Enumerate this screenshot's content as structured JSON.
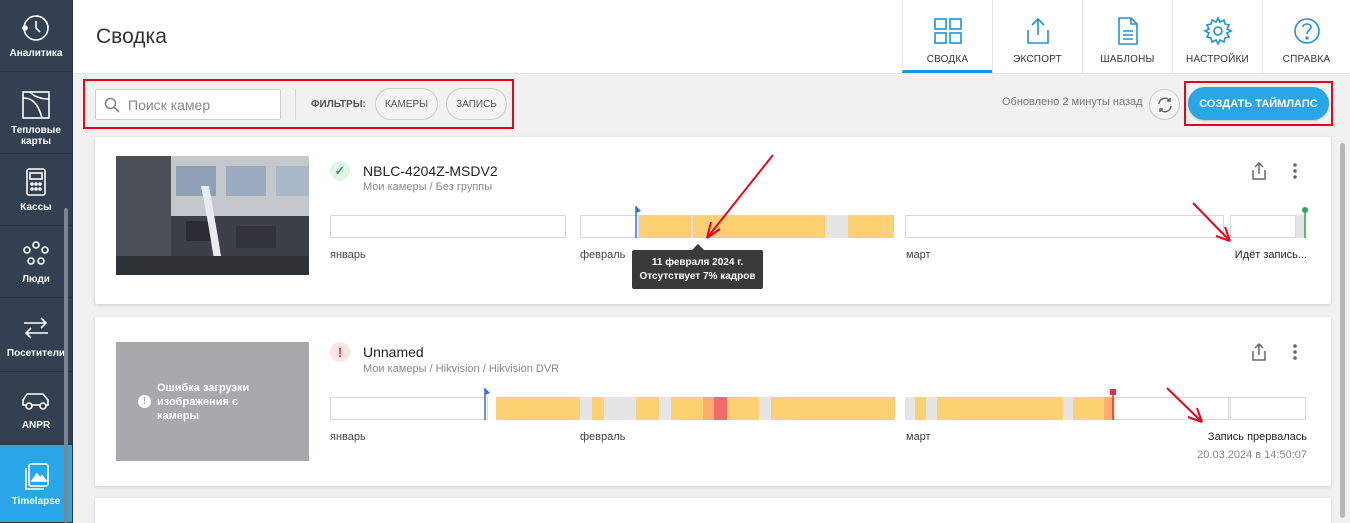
{
  "sidebar": {
    "items": [
      {
        "label": "Аналитика",
        "icon": "analytics-icon"
      },
      {
        "label": "Тепловые карты",
        "icon": "heatmap-icon"
      },
      {
        "label": "Кассы",
        "icon": "cash-register-icon"
      },
      {
        "label": "Люди",
        "icon": "people-icon"
      },
      {
        "label": "Посетители",
        "icon": "visitors-icon"
      },
      {
        "label": "ANPR",
        "icon": "car-icon"
      },
      {
        "label": "Timelapse",
        "icon": "timelapse-icon",
        "active": true
      }
    ]
  },
  "header": {
    "title": "Сводка",
    "nav": [
      {
        "label": "СВОДКА",
        "icon": "dashboard-icon",
        "active": true
      },
      {
        "label": "ЭКСПОРТ",
        "icon": "export-icon"
      },
      {
        "label": "ШАБЛОНЫ",
        "icon": "template-icon"
      },
      {
        "label": "НАСТРОЙКИ",
        "icon": "gear-icon"
      },
      {
        "label": "СПРАВКА",
        "icon": "help-icon"
      }
    ]
  },
  "toolbar": {
    "search_placeholder": "Поиск камер",
    "filters_label": "ФИЛЬТРЫ:",
    "chips": [
      "КАМЕРЫ",
      "ЗАПИСЬ"
    ],
    "updated": "Обновлено 2 минуты назад",
    "create_label": "СОЗДАТЬ ТАЙМЛАПС"
  },
  "cameras": [
    {
      "name": "NBLC-4204Z-MSDV2",
      "path": "Мои камеры / Без группы",
      "status": "ok",
      "months": [
        "январь",
        "февраль",
        "март"
      ],
      "recording_status": "Идёт запись...",
      "tooltip": {
        "date": "11 февраля 2024 г.",
        "info": "Отсутствует 7% кадров"
      }
    },
    {
      "name": "Unnamed",
      "path": "Мои камеры / Hikvision / Hikvision DVR",
      "status": "error",
      "status_symbol": "!",
      "thumb_error": "Ошибка загрузки изображения с камеры",
      "months": [
        "январь",
        "февраль",
        "март"
      ],
      "recording_status": "Запись прервалась",
      "recording_date": "20.03.2024 в 14:50:07"
    }
  ],
  "colors": {
    "accent": "#29a6e8",
    "sidebar": "#334052",
    "timeline_recorded": "#fdd072",
    "timeline_gap": "#e5e5e5",
    "timeline_warning": "#ffad6e",
    "timeline_error": "#f36a6a",
    "annotation": "#e0081b"
  }
}
